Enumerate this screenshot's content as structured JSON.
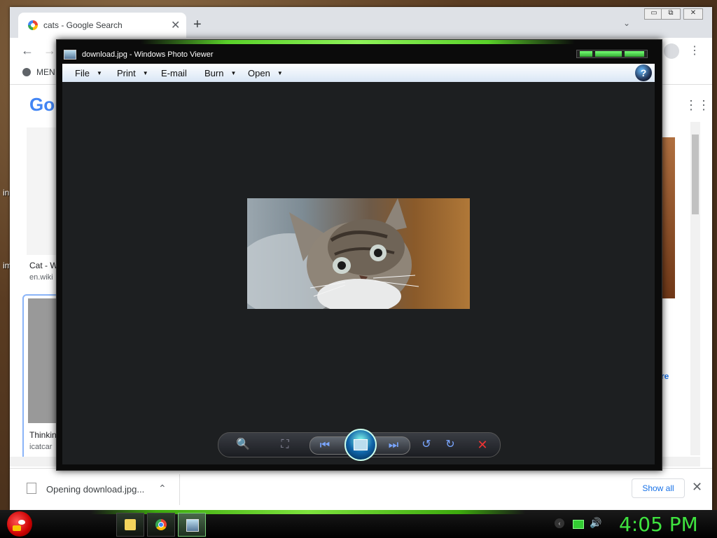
{
  "desktop": {
    "label_1": "in",
    "label_2": "im"
  },
  "browser": {
    "tab_title": "cats - Google Search",
    "tab_close": "✕",
    "new_tab": "+",
    "tab_search": "⌄",
    "win_min": "▭",
    "win_max": "⧉",
    "win_close": "✕",
    "back": "←",
    "forward": "→",
    "menu": "⋮",
    "bookmark": "MEN",
    "logo": "Go",
    "apps": "⋮⋮",
    "results": [
      {
        "title": "Cat - W",
        "source": "en.wiki"
      },
      {
        "title": "Thinkin",
        "source": "icatcar"
      }
    ],
    "side_more": "re"
  },
  "download_bar": {
    "file_text": "Opening download.jpg...",
    "chevron": "⌃",
    "show_all": "Show all",
    "close": "✕"
  },
  "viewer": {
    "title": "download.jpg - Windows Photo Viewer",
    "menu": [
      {
        "label": "File",
        "has_arrow": true
      },
      {
        "label": "Print",
        "has_arrow": true
      },
      {
        "label": "E-mail",
        "has_arrow": false
      },
      {
        "label": "Burn",
        "has_arrow": true
      },
      {
        "label": "Open",
        "has_arrow": true
      }
    ],
    "arrow": "▼",
    "help": "?",
    "nav": {
      "zoom": "🔍",
      "fit": "⛶",
      "prev": "⏮",
      "next": "⏭",
      "rotate_ccw": "↺",
      "rotate_cw": "↻",
      "delete": "✕"
    }
  },
  "taskbar": {
    "clock": "4:05 PM",
    "tray_back": "‹",
    "tray_volume": "🔊"
  },
  "colors": {
    "accent_green": "#3fe33f",
    "viewer_bg": "#1d1f21",
    "link_blue": "#1a73e8"
  }
}
